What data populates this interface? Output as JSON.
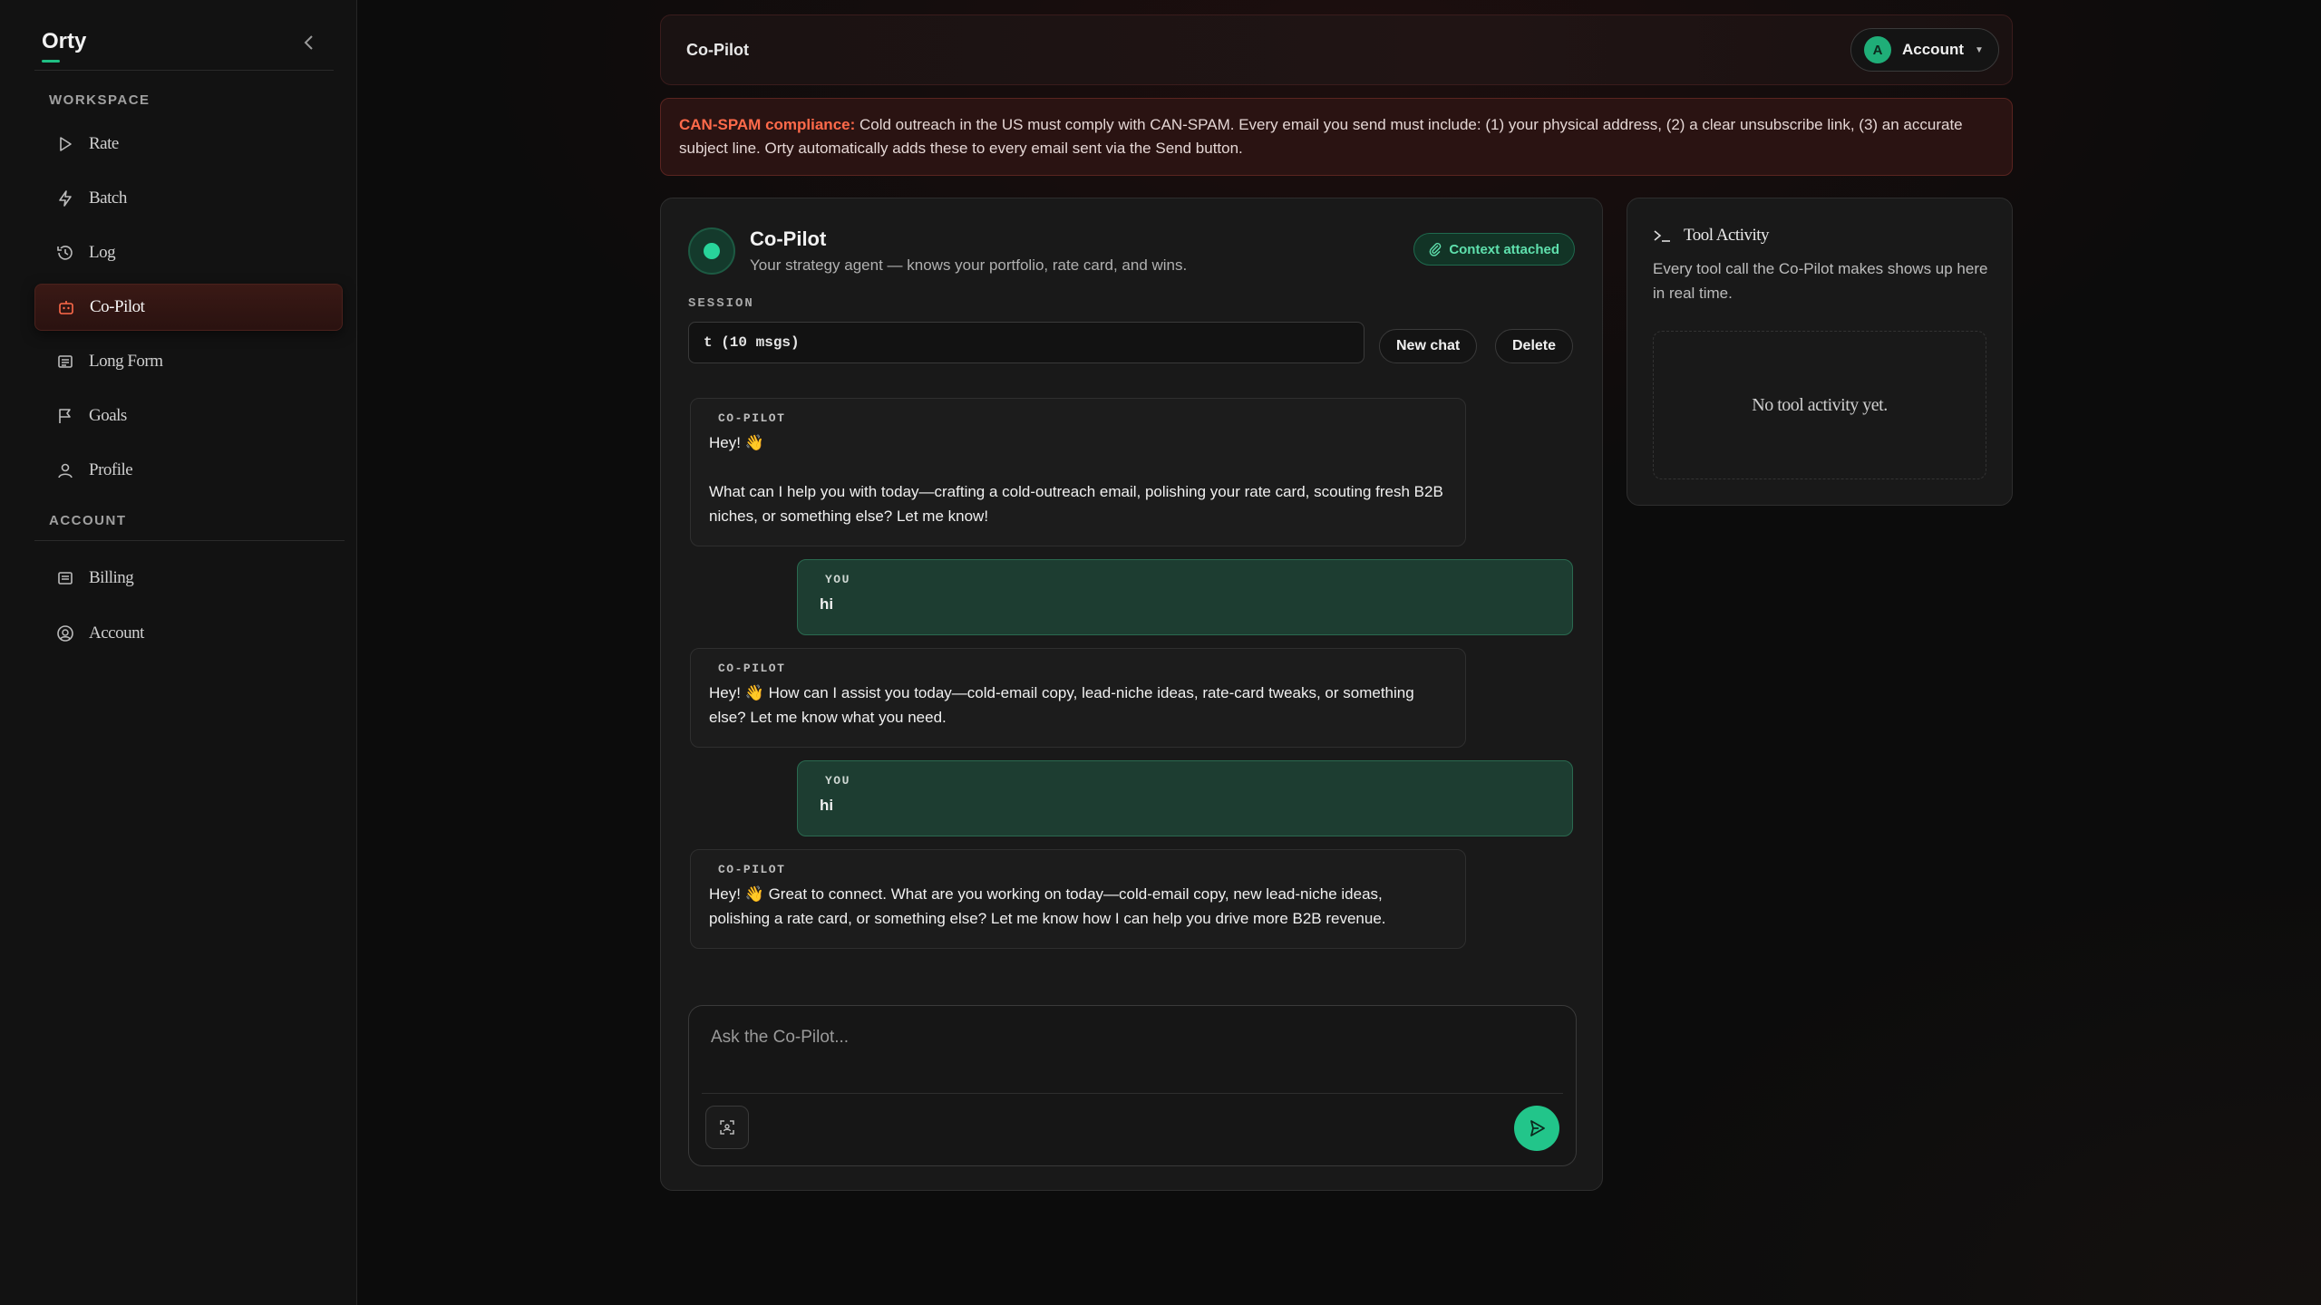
{
  "app": {
    "brand": "Orty"
  },
  "sidebar": {
    "workspace_label": "WORKSPACE",
    "account_label": "ACCOUNT",
    "workspace_items": [
      {
        "label": "Rate",
        "icon": "play-icon"
      },
      {
        "label": "Batch",
        "icon": "bolt-icon"
      },
      {
        "label": "Log",
        "icon": "history-icon"
      },
      {
        "label": "Co-Pilot",
        "icon": "robot-icon",
        "active": true
      },
      {
        "label": "Long Form",
        "icon": "document-icon"
      },
      {
        "label": "Goals",
        "icon": "flag-icon"
      },
      {
        "label": "Profile",
        "icon": "user-icon"
      }
    ],
    "account_items": [
      {
        "label": "Billing",
        "icon": "billing-icon"
      },
      {
        "label": "Account",
        "icon": "account-circle-icon"
      }
    ]
  },
  "header": {
    "title": "Co-Pilot",
    "account_initial": "A",
    "account_label": "Account"
  },
  "alert": {
    "strong": "CAN-SPAM compliance:",
    "text": " Cold outreach in the US must comply with CAN-SPAM. Every email you send must include: (1) your physical address, (2) a clear unsubscribe link, (3) an accurate subject line. Orty automatically adds these to every email sent via the Send button."
  },
  "chat": {
    "title": "Co-Pilot",
    "subtitle": "Your strategy agent — knows your portfolio, rate card, and wins.",
    "context_badge": "Context attached",
    "session_label": "SESSION",
    "session_value": "t (10 msgs)",
    "new_chat_label": "New chat",
    "delete_label": "Delete",
    "messages": [
      {
        "role": "CO-PILOT",
        "type": "bot",
        "text": " Hey! 👋\n\nWhat can I help you with today—crafting a cold-outreach email, polishing your rate card, scouting fresh B2B niches, or something else? Let me know!"
      },
      {
        "role": "YOU",
        "type": "user",
        "text": "hi"
      },
      {
        "role": "CO-PILOT",
        "type": "bot",
        "text": " Hey! 👋 How can I assist you today—cold-email copy, lead-niche ideas, rate-card tweaks, or something else? Let me know what you need."
      },
      {
        "role": "YOU",
        "type": "user",
        "text": "hi"
      },
      {
        "role": "CO-PILOT",
        "type": "bot",
        "text": " Hey! 👋 Great to connect. What are you working on today—cold-email copy, new lead-niche ideas, polishing a rate card, or something else? Let me know how I can help you drive more B2B revenue."
      }
    ],
    "composer_placeholder": "Ask the Co-Pilot..."
  },
  "tools": {
    "title": "Tool Activity",
    "description": "Every tool call the Co-Pilot makes shows up here in real time.",
    "empty": "No tool activity yet."
  },
  "colors": {
    "accent": "#22c58a",
    "alert": "#ff6a4a",
    "active_nav": "#3a1915"
  }
}
